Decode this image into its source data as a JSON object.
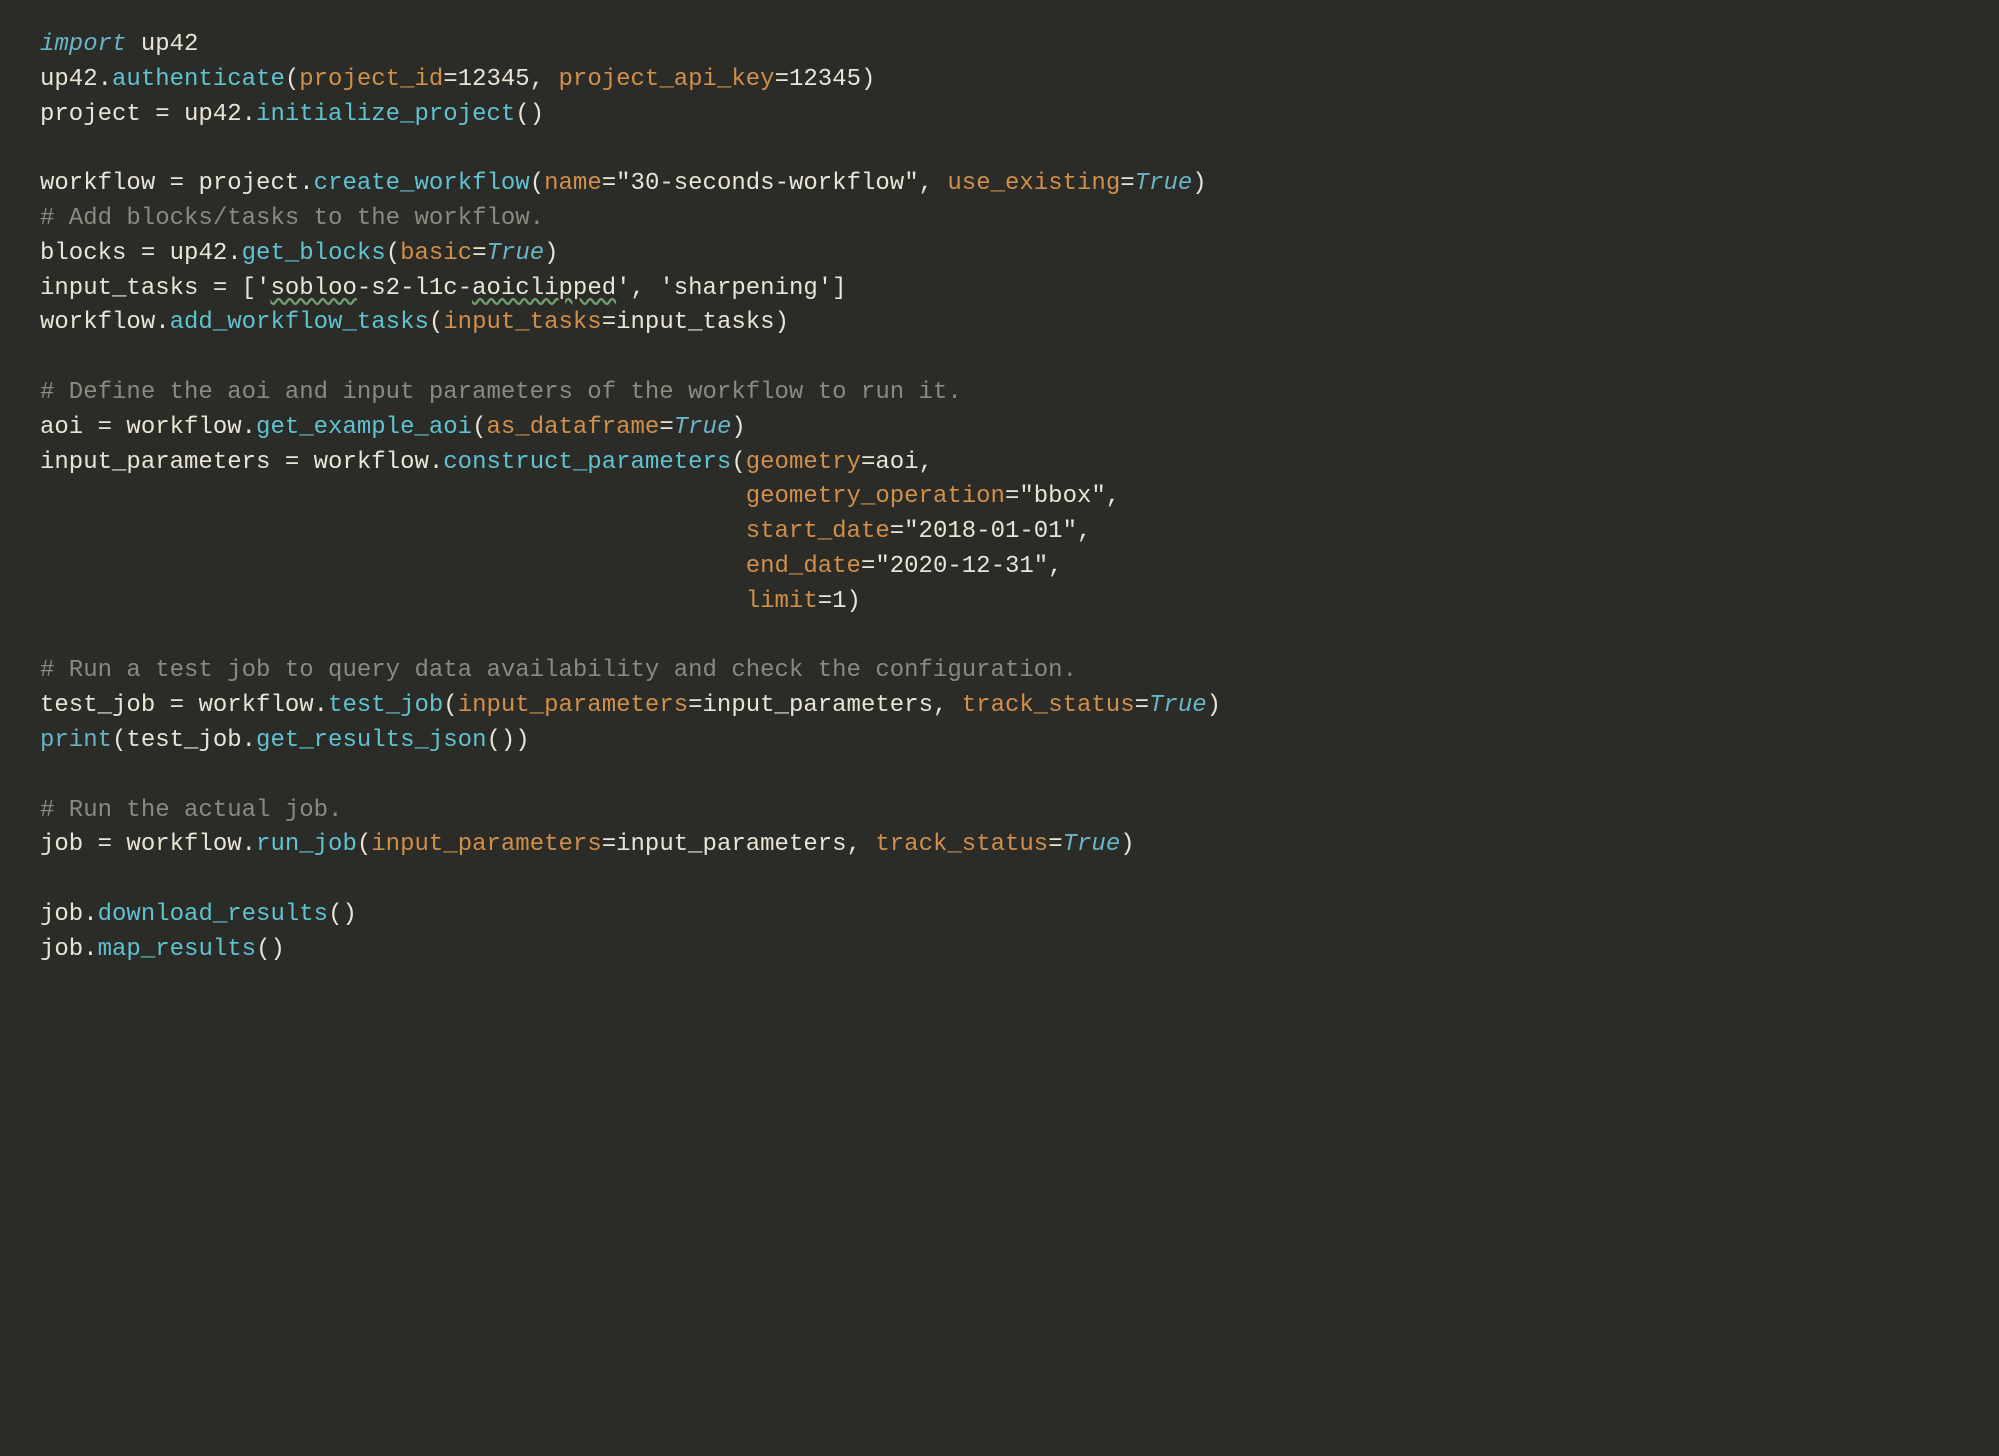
{
  "line1": {
    "import": "import",
    "mod": "up42"
  },
  "line2": {
    "mod": "up42",
    "dot": ".",
    "fn": "authenticate",
    "op": "(",
    "p1": "project_id",
    "eq": "=",
    "n1": "12345",
    "c1": ", ",
    "p2": "project_api_key",
    "n2": "12345",
    "cp": ")"
  },
  "line3": {
    "lhs": "project ",
    "eq": "= ",
    "mod": "up42",
    "dot": ".",
    "fn": "initialize_project",
    "par": "()"
  },
  "line4": {
    "blank": ""
  },
  "line5": {
    "lhs": "workflow ",
    "eq": "= ",
    "obj": "project",
    "dot": ".",
    "fn": "create_workflow",
    "op": "(",
    "p1": "name",
    "e": "=",
    "s1": "\"30-seconds-workflow\"",
    "c": ", ",
    "p2": "use_existing",
    "b1": "True",
    "cp": ")"
  },
  "line6": {
    "comment": "# Add blocks/tasks to the workflow."
  },
  "line7": {
    "lhs": "blocks ",
    "eq": "= ",
    "mod": "up42",
    "dot": ".",
    "fn": "get_blocks",
    "op": "(",
    "p1": "basic",
    "e": "=",
    "b1": "True",
    "cp": ")"
  },
  "line8": {
    "lhs": "input_tasks ",
    "eq": "= [",
    "q1": "'",
    "sp1": "sobloo",
    "mid1": "-s2-l1c-",
    "sp2": "aoiclipped",
    "q2": "'",
    "c": ", ",
    "s2": "'sharpening'",
    "cb": "]"
  },
  "line9": {
    "obj": "workflow",
    "dot": ".",
    "fn": "add_workflow_tasks",
    "op": "(",
    "p1": "input_tasks",
    "e": "=",
    "v": "input_tasks",
    "cp": ")"
  },
  "line10": {
    "blank": ""
  },
  "line11": {
    "comment": "# Define the aoi and input parameters of the workflow to run it."
  },
  "line12": {
    "lhs": "aoi ",
    "eq": "= ",
    "obj": "workflow",
    "dot": ".",
    "fn": "get_example_aoi",
    "op": "(",
    "p1": "as_dataframe",
    "e": "=",
    "b1": "True",
    "cp": ")"
  },
  "line13": {
    "lhs": "input_parameters ",
    "eq": "= ",
    "obj": "workflow",
    "dot": ".",
    "fn": "construct_parameters",
    "op": "(",
    "p1": "geometry",
    "e": "=",
    "v": "aoi",
    "c": ","
  },
  "line13b": {
    "indent": "                                                 ",
    "p": "geometry_operation",
    "e": "=",
    "s": "\"bbox\"",
    "c": ","
  },
  "line13c": {
    "indent": "                                                 ",
    "p": "start_date",
    "e": "=",
    "s": "\"2018-01-01\"",
    "c": ","
  },
  "line13d": {
    "indent": "                                                 ",
    "p": "end_date",
    "e": "=",
    "s": "\"2020-12-31\"",
    "c": ","
  },
  "line13e": {
    "indent": "                                                 ",
    "p": "limit",
    "e": "=",
    "n": "1",
    "cp": ")"
  },
  "line14": {
    "blank": ""
  },
  "line15": {
    "comment": "# Run a test job to query data availability and check the configuration."
  },
  "line16": {
    "lhs": "test_job ",
    "eq": "= ",
    "obj": "workflow",
    "dot": ".",
    "fn": "test_job",
    "op": "(",
    "p1": "input_parameters",
    "e": "=",
    "v": "input_parameters",
    "c": ", ",
    "p2": "track_status",
    "b1": "True",
    "cp": ")"
  },
  "line17": {
    "fn": "print",
    "op": "(",
    "obj": "test_job",
    "dot": ".",
    "fn2": "get_results_json",
    "par": "()",
    "cp": ")"
  },
  "line18": {
    "blank": ""
  },
  "line19": {
    "comment": "# Run the actual job."
  },
  "line20": {
    "lhs": "job ",
    "eq": "= ",
    "obj": "workflow",
    "dot": ".",
    "fn": "run_job",
    "op": "(",
    "p1": "input_parameters",
    "e": "=",
    "v": "input_parameters",
    "c": ", ",
    "p2": "track_status",
    "b1": "True",
    "cp": ")"
  },
  "line21": {
    "blank": ""
  },
  "line22": {
    "obj": "job",
    "dot": ".",
    "fn": "download_results",
    "par": "()"
  },
  "line23": {
    "obj": "job",
    "dot": ".",
    "fn": "map_results",
    "par": "()"
  }
}
